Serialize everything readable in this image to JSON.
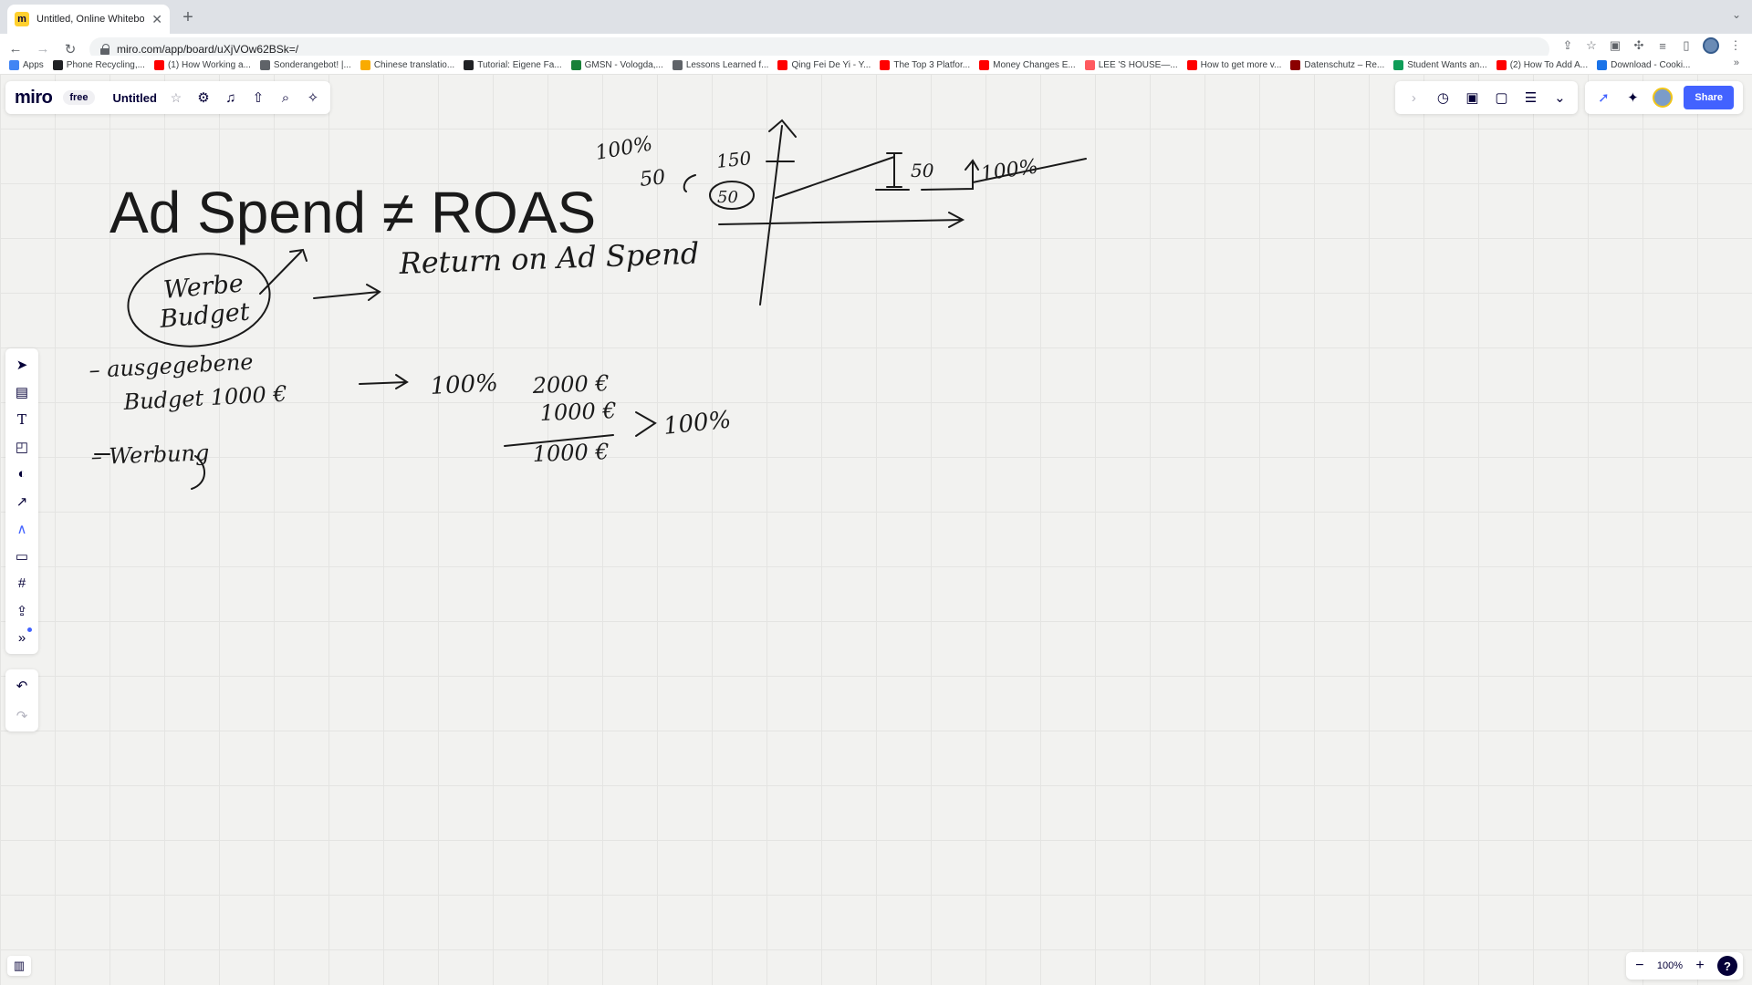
{
  "browser": {
    "tab_title": "Untitled, Online Whiteboard for",
    "url": "miro.com/app/board/uXjVOw62BSk=/",
    "bookmarks": [
      {
        "label": "Apps",
        "color": "#4285f4"
      },
      {
        "label": "Phone Recycling,...",
        "color": "#202124"
      },
      {
        "label": "(1) How Working a...",
        "color": "#ff0000"
      },
      {
        "label": "Sonderangebot! |...",
        "color": "#5f6368"
      },
      {
        "label": "Chinese translatio...",
        "color": "#f9ab00"
      },
      {
        "label": "Tutorial: Eigene Fa...",
        "color": "#202124"
      },
      {
        "label": "GMSN - Vologda,...",
        "color": "#188038"
      },
      {
        "label": "Lessons Learned f...",
        "color": "#5f6368"
      },
      {
        "label": "Qing Fei De Yi - Y...",
        "color": "#ff0000"
      },
      {
        "label": "The Top 3 Platfor...",
        "color": "#ff0000"
      },
      {
        "label": "Money Changes E...",
        "color": "#ff0000"
      },
      {
        "label": "LEE 'S HOUSE—...",
        "color": "#ff5a5f"
      },
      {
        "label": "How to get more v...",
        "color": "#ff0000"
      },
      {
        "label": "Datenschutz – Re...",
        "color": "#8b0000"
      },
      {
        "label": "Student Wants an...",
        "color": "#0f9d58"
      },
      {
        "label": "(2) How To Add A...",
        "color": "#ff0000"
      },
      {
        "label": "Download - Cooki...",
        "color": "#1a73e8"
      }
    ]
  },
  "miro": {
    "logo": "miro",
    "plan": "free",
    "board_title": "Untitled",
    "share_label": "Share",
    "zoom_level": "100%",
    "accent_color": "#4262ff"
  },
  "board": {
    "heading": "Ad Spend ≠ ROAS",
    "notes": {
      "roas_meaning": "Return on Ad Spend",
      "circle_line1": "Werbe",
      "circle_line2": "Budget",
      "item1_line1": "– ausgegebene",
      "item1_line2": "Budget 1000 €",
      "item2": "– Werbung",
      "calc_pct": "100%",
      "calc_top": "2000 €",
      "calc_minus": "1000 €",
      "calc_result": "1000 €",
      "calc_ratio": "100%",
      "graph_pct": "100%",
      "graph_150": "150",
      "graph_50": "50",
      "graph_50b": "50",
      "graph_circled": "50",
      "graph_right_pct": "100%"
    }
  }
}
